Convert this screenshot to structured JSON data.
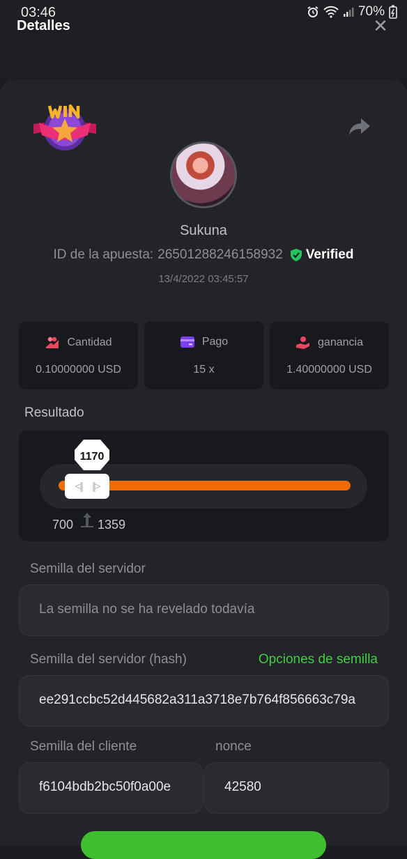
{
  "status_bar": {
    "time": "03:46",
    "battery": "70%"
  },
  "header": {
    "title": "Detalles"
  },
  "bet": {
    "username": "Sukuna",
    "bet_id_label": "ID de la apuesta:",
    "bet_id": "26501288246158932",
    "verified_label": "Verified",
    "datetime": "13/4/2022 03:45:57"
  },
  "stats": [
    {
      "label": "Cantidad",
      "value": "0.10000000 USD",
      "icon": "coins-icon",
      "color": "#e8475f"
    },
    {
      "label": "Pago",
      "value": "15 x",
      "icon": "card-icon",
      "color": "#7b3ff2"
    },
    {
      "label": "ganancia",
      "value": "1.40000000 USD",
      "icon": "hand-coin-icon",
      "color": "#e8475f"
    }
  ],
  "result": {
    "label": "Resultado",
    "value": "1170",
    "min": "700",
    "max": "1359",
    "accent": "#f06a06"
  },
  "server_seed": {
    "label": "Semilla del servidor",
    "value": "La semilla no se ha revelado todavía"
  },
  "server_seed_hash": {
    "label": "Semilla del servidor (hash)",
    "options_link": "Opciones de semilla",
    "value": "ee291ccbc52d445682a311a3718e7b764f856663c79a"
  },
  "client_seed": {
    "label": "Semilla del cliente",
    "value": "f6104bdb2bc50f0a00e"
  },
  "nonce": {
    "label": "nonce",
    "value": "42580"
  }
}
